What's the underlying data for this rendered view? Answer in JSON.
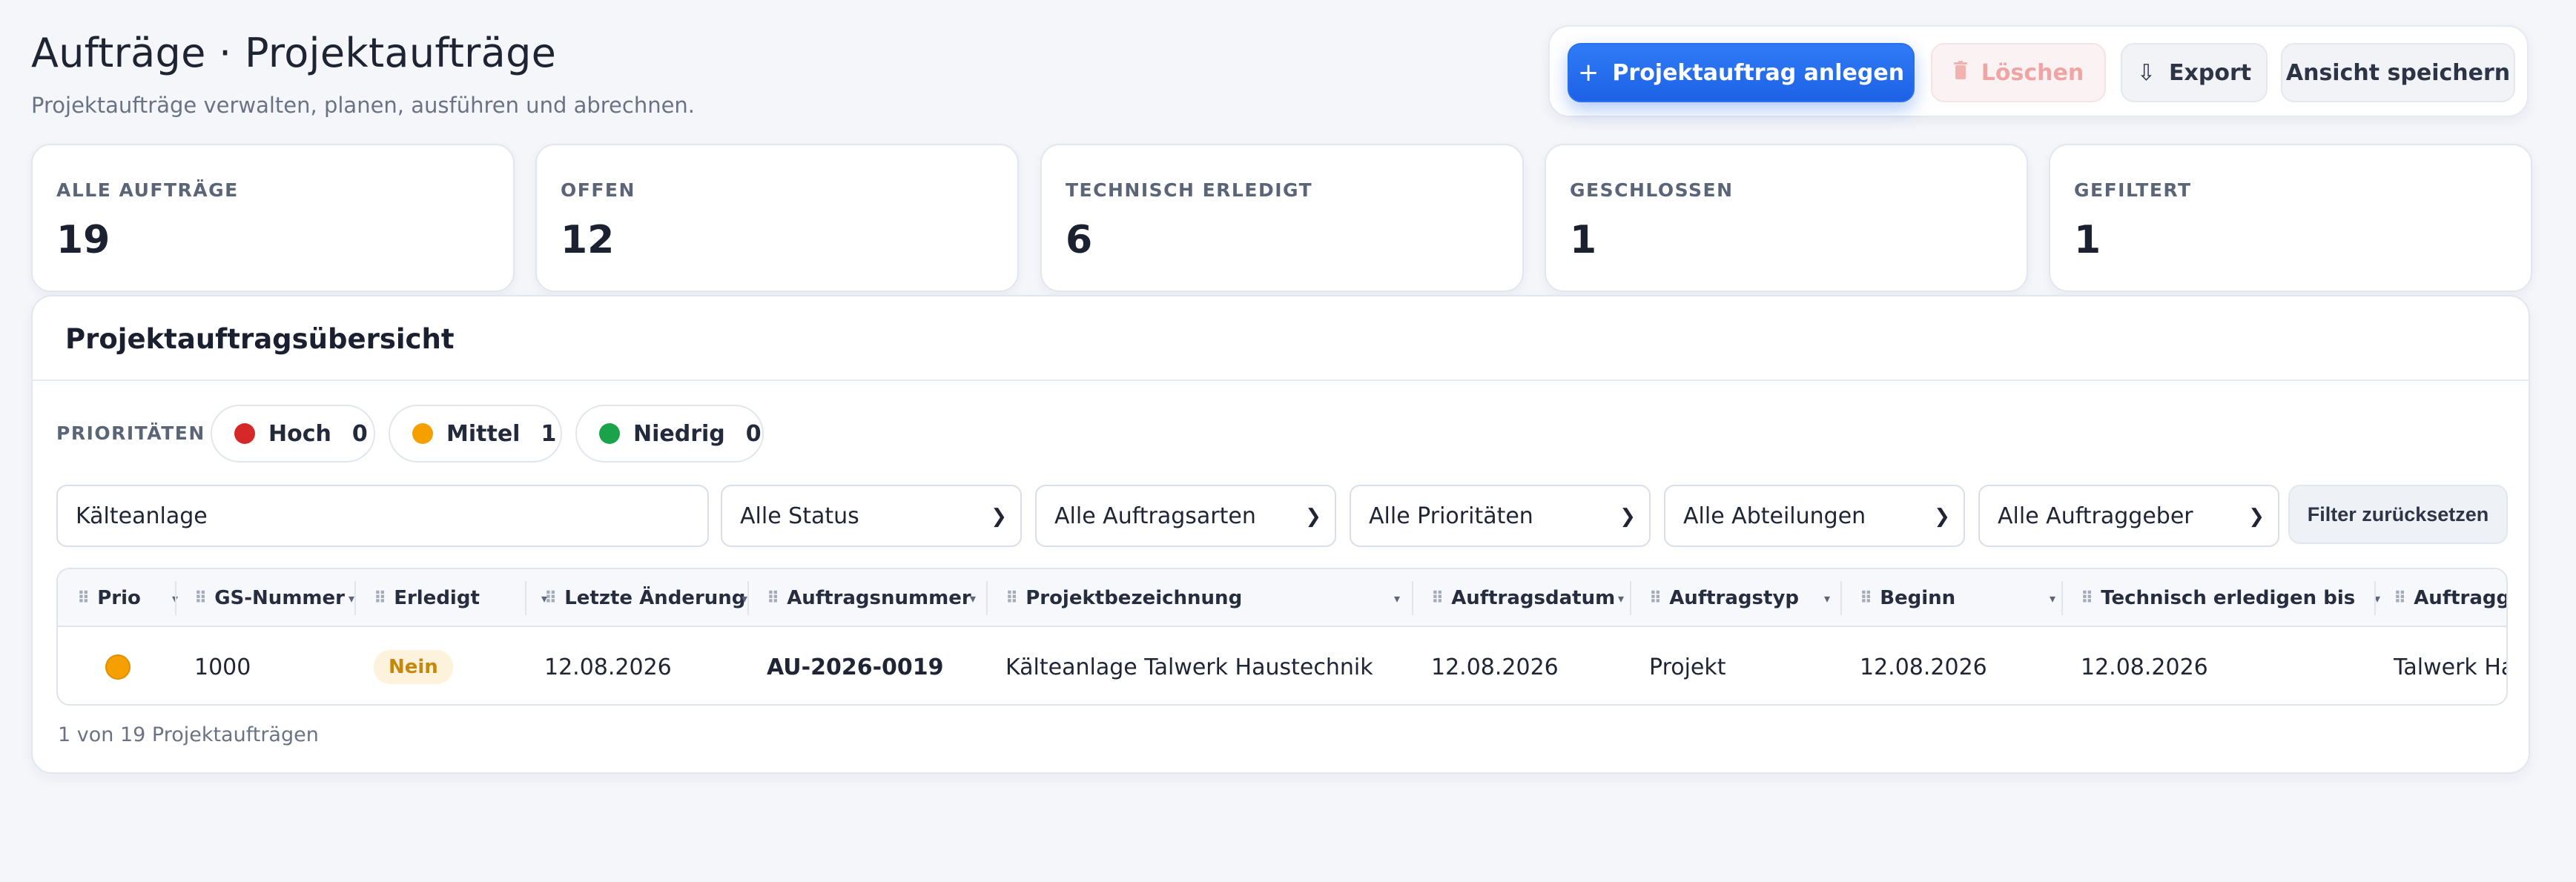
{
  "header": {
    "title": "Aufträge · Projektaufträge",
    "subtitle": "Projektaufträge verwalten, planen, ausführen und abrechnen."
  },
  "toolbar": {
    "create_label": "Projektauftrag anlegen",
    "delete_label": "Löschen",
    "export_label": "Export",
    "save_view_label": "Ansicht speichern"
  },
  "kpis": [
    {
      "label": "ALLE AUFTRÄGE",
      "value": "19"
    },
    {
      "label": "OFFEN",
      "value": "12"
    },
    {
      "label": "TECHNISCH ERLEDIGT",
      "value": "6"
    },
    {
      "label": "GESCHLOSSEN",
      "value": "1"
    },
    {
      "label": "GEFILTERT",
      "value": "1"
    }
  ],
  "panel": {
    "title": "Projektauftragsübersicht",
    "priorities_label": "PRIORITÄTEN",
    "priorities": [
      {
        "label": "Hoch",
        "count": "0",
        "color": "#d62828"
      },
      {
        "label": "Mittel",
        "count": "1",
        "color": "#f5a000"
      },
      {
        "label": "Niedrig",
        "count": "0",
        "color": "#1aa34a"
      }
    ]
  },
  "filters": {
    "search_value": "Kälteanlage",
    "status": "Alle Status",
    "order_types": "Alle Auftragsarten",
    "priorities": "Alle Prioritäten",
    "departments": "Alle Abteilungen",
    "clients": "Alle Auftraggeber",
    "reset_label": "Filter zurücksetzen"
  },
  "table": {
    "columns": [
      "Prio",
      "GS-Nummer",
      "Erledigt",
      "Letzte Änderung",
      "Auftragsnummer",
      "Projektbezeichnung",
      "Auftragsdatum",
      "Auftragstyp",
      "Beginn",
      "Technisch erledigen bis",
      "Auftraggeber"
    ],
    "rows": [
      {
        "prio_color": "#f5a000",
        "gs_nummer": "1000",
        "erledigt": "Nein",
        "letzte_aenderung": "12.08.2026",
        "auftragsnummer": "AU-2026-0019",
        "projektbezeichnung": "Kälteanlage Talwerk Haustechnik",
        "auftragsdatum": "12.08.2026",
        "auftragstyp": "Projekt",
        "beginn": "12.08.2026",
        "technisch_erledigen_bis": "12.08.2026",
        "auftraggeber": "Talwerk Hauste"
      }
    ]
  },
  "footer": {
    "count_text": "1 von 19 Projektaufträgen"
  }
}
